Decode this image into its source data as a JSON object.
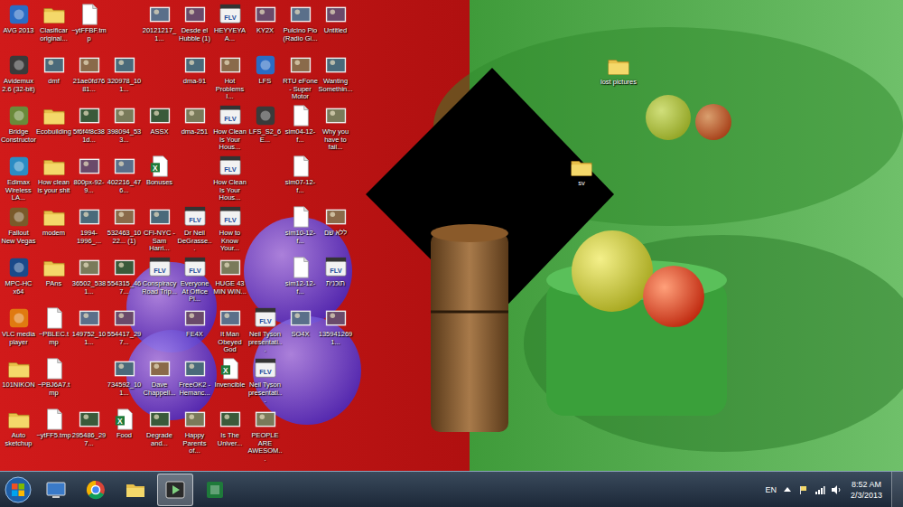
{
  "desktop_icons": [
    {
      "label": "AVG 2013",
      "kind": "app"
    },
    {
      "label": "Avidemux 2.6 (32-bit)",
      "kind": "app"
    },
    {
      "label": "Bridge Constructor",
      "kind": "app"
    },
    {
      "label": "Edimax Wireless LA...",
      "kind": "app"
    },
    {
      "label": "Fallout New Vegas",
      "kind": "app"
    },
    {
      "label": "MPC-HC x64",
      "kind": "app"
    },
    {
      "label": "VLC media player",
      "kind": "app"
    },
    {
      "label": "101NIKON",
      "kind": "folder"
    },
    {
      "label": "Auto sketchup",
      "kind": "folder"
    },
    {
      "label": "Clasificar original...",
      "kind": "folder"
    },
    {
      "label": "dmf",
      "kind": "image"
    },
    {
      "label": "Ecobuilding",
      "kind": "folder"
    },
    {
      "label": "How clean is your shit",
      "kind": "folder"
    },
    {
      "label": "modem",
      "kind": "folder"
    },
    {
      "label": "PAns",
      "kind": "folder"
    },
    {
      "label": "~PBLEC.tmp",
      "kind": "file"
    },
    {
      "label": "~PBJ6A7.tmp",
      "kind": "file"
    },
    {
      "label": "~ytFF5.tmp",
      "kind": "file"
    },
    {
      "label": "~ytFFBF.tmp",
      "kind": "file"
    },
    {
      "label": "21ae0fd7681...",
      "kind": "image"
    },
    {
      "label": "5f6f4f8c381d...",
      "kind": "image"
    },
    {
      "label": "800px-92-9...",
      "kind": "image"
    },
    {
      "label": "1994-1996_...",
      "kind": "image"
    },
    {
      "label": "36502_5381...",
      "kind": "image"
    },
    {
      "label": "149752_101...",
      "kind": "image"
    },
    {
      "label": "",
      "kind": "empty"
    },
    {
      "label": "295486_297...",
      "kind": "image"
    },
    {
      "label": "",
      "kind": "empty"
    },
    {
      "label": "320978_101...",
      "kind": "image"
    },
    {
      "label": "398094_533...",
      "kind": "image"
    },
    {
      "label": "402216_476...",
      "kind": "image"
    },
    {
      "label": "532463_1022... (1)",
      "kind": "image"
    },
    {
      "label": "554315_467...",
      "kind": "image"
    },
    {
      "label": "554417_297...",
      "kind": "image"
    },
    {
      "label": "734592_101...",
      "kind": "image"
    },
    {
      "label": "Food",
      "kind": "sheet"
    },
    {
      "label": "20121217_1...",
      "kind": "image"
    },
    {
      "label": "",
      "kind": "empty"
    },
    {
      "label": "ASSX",
      "kind": "image"
    },
    {
      "label": "Bonuses",
      "kind": "sheet"
    },
    {
      "label": "CFI-NYC - Sam Harri...",
      "kind": "image"
    },
    {
      "label": "Conspiracy Road Trip...",
      "kind": "video"
    },
    {
      "label": "",
      "kind": "empty"
    },
    {
      "label": "Dave Chappell...",
      "kind": "image"
    },
    {
      "label": "Degrade and...",
      "kind": "image"
    },
    {
      "label": "Desde el Hubble (1)",
      "kind": "image"
    },
    {
      "label": "dma-91",
      "kind": "image"
    },
    {
      "label": "dma-251",
      "kind": "image"
    },
    {
      "label": "",
      "kind": "empty"
    },
    {
      "label": "Dr Neil DeGrasse...",
      "kind": "video"
    },
    {
      "label": "Everyone At Office Pl...",
      "kind": "video"
    },
    {
      "label": "FE4X",
      "kind": "image"
    },
    {
      "label": "FreeOK2 - Hemanc...",
      "kind": "image"
    },
    {
      "label": "Happy Parents of...",
      "kind": "image"
    },
    {
      "label": "HEYYEYAA...",
      "kind": "video"
    },
    {
      "label": "Hot Problems I...",
      "kind": "image"
    },
    {
      "label": "How Clean Is Your Hous...",
      "kind": "video"
    },
    {
      "label": "How Clean Is Your Hous...",
      "kind": "video"
    },
    {
      "label": "How to Know Your...",
      "kind": "video"
    },
    {
      "label": "HUGE 43 MIN WIN...",
      "kind": "image"
    },
    {
      "label": "It Man Obeyed God",
      "kind": "image"
    },
    {
      "label": "Invencible",
      "kind": "sheet"
    },
    {
      "label": "Is The Univer...",
      "kind": "image"
    },
    {
      "label": "KY2X",
      "kind": "image"
    },
    {
      "label": "LFS",
      "kind": "app"
    },
    {
      "label": "LFS_S2_6E...",
      "kind": "app"
    },
    {
      "label": "",
      "kind": "empty"
    },
    {
      "label": "",
      "kind": "empty"
    },
    {
      "label": "",
      "kind": "empty"
    },
    {
      "label": "Neil Tyson presentati...",
      "kind": "video"
    },
    {
      "label": "Neil Tyson presentati...",
      "kind": "video"
    },
    {
      "label": "PEOPLE ARE AWESOM...",
      "kind": "image"
    },
    {
      "label": "Pulcino Pio (Radio Gi...",
      "kind": "image"
    },
    {
      "label": "RTU eFone - Super Motor",
      "kind": "image"
    },
    {
      "label": "sim04-12-f...",
      "kind": "file"
    },
    {
      "label": "sim07-12-f...",
      "kind": "file"
    },
    {
      "label": "sim10-12-f...",
      "kind": "file"
    },
    {
      "label": "sim12-12-f...",
      "kind": "file"
    },
    {
      "label": "SO4X",
      "kind": "image"
    },
    {
      "label": "",
      "kind": "empty"
    },
    {
      "label": "",
      "kind": "empty"
    },
    {
      "label": "Untitled",
      "kind": "image"
    },
    {
      "label": "Wanting Somethin...",
      "kind": "image"
    },
    {
      "label": "Why you have to fail...",
      "kind": "image"
    },
    {
      "label": "",
      "kind": "empty"
    },
    {
      "label": "ללא שם",
      "kind": "image"
    },
    {
      "label": "תוכנית",
      "kind": "video"
    },
    {
      "label": "1359412691...",
      "kind": "image"
    },
    {
      "label": "",
      "kind": "empty"
    },
    {
      "label": "",
      "kind": "empty"
    }
  ],
  "free_icons": [
    {
      "label": "lost pictures",
      "kind": "folder"
    },
    {
      "label": "sv",
      "kind": "folder"
    }
  ],
  "file_badges": {
    "video": "FLV",
    "sheet": "X"
  },
  "taskbar": {
    "items": [
      {
        "kind": "explorer",
        "active": false
      },
      {
        "kind": "chrome",
        "active": false
      },
      {
        "kind": "folder",
        "active": false
      },
      {
        "kind": "media",
        "active": true
      },
      {
        "kind": "excel",
        "active": false
      }
    ],
    "language": "EN",
    "time": "8:52 AM",
    "date": "2/3/2013"
  }
}
